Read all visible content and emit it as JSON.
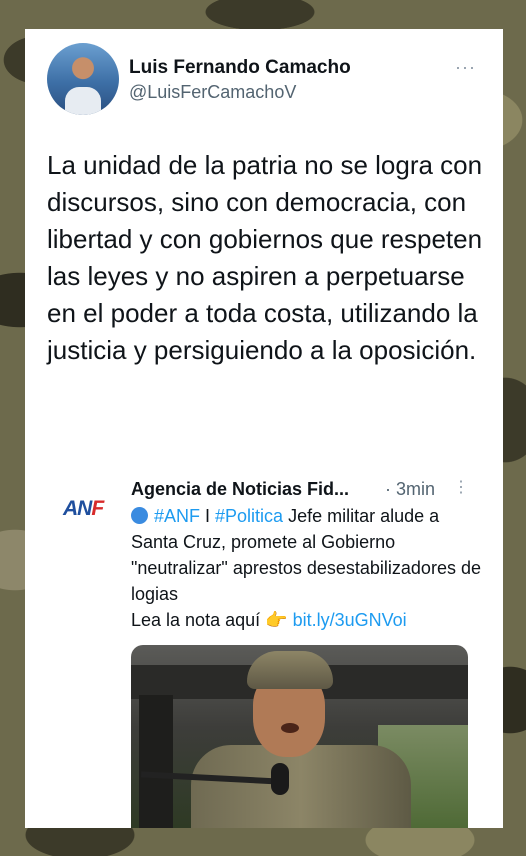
{
  "tweet": {
    "author_name": "Luis Fernando Camacho",
    "author_handle": "@LuisFerCamachoV",
    "more_icon": "···",
    "text": "La unidad de la patria no se logra con discursos, sino con democracia, con libertad y con gobiernos que respeten las leyes y no aspiren a perpetuarse en el poder a toda costa, utilizando la justicia y persiguiendo a la oposición."
  },
  "quoted": {
    "logo_text_a": "AN",
    "logo_text_b": "F",
    "author_name": "Agencia de Noticias Fid...",
    "time": "· 3min",
    "more_icon": "⋮",
    "hashtag_anf": "#ANF",
    "separator": " I ",
    "hashtag_politica": "#Politica",
    "body": " Jefe militar alude a Santa Cruz, promete al Gobierno \"neutralizar\" aprestos desestabilizadores de logias",
    "read_text": "Lea la nota aquí ",
    "hand_icon": "👉",
    "link": "bit.ly/3uGNVoi"
  },
  "colors": {
    "link": "#1d9bf0",
    "text": "#0f1419",
    "muted": "#536471"
  }
}
